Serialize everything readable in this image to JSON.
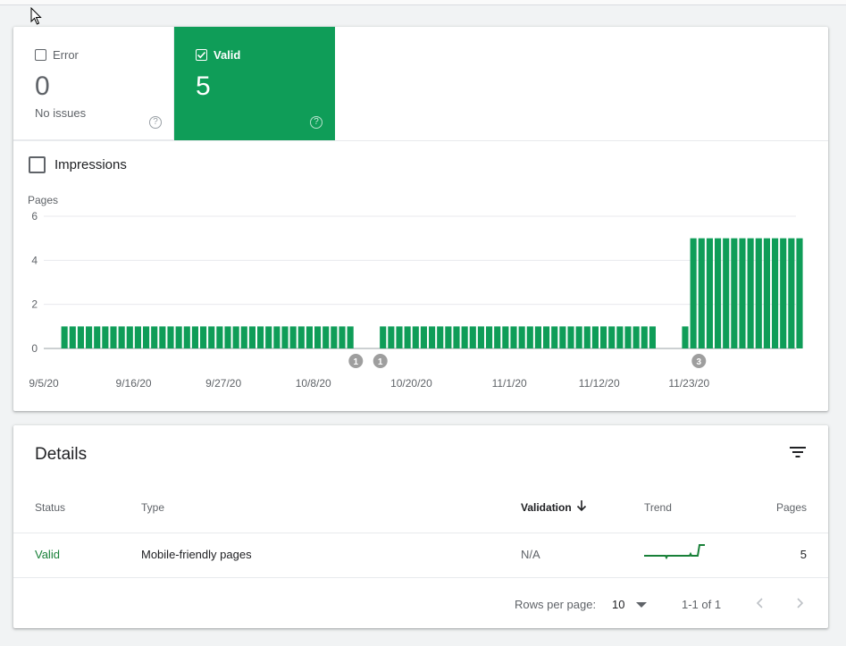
{
  "summary": {
    "error": {
      "label": "Error",
      "count": "0",
      "sub": "No issues"
    },
    "valid": {
      "label": "Valid",
      "count": "5"
    },
    "help_glyph": "?",
    "impressions_label": "Impressions"
  },
  "colors": {
    "valid_green": "#0f9d58",
    "status_green": "#188038",
    "annotation_grey": "#9e9e9e"
  },
  "chart_data": {
    "type": "bar",
    "ylabel": "Pages",
    "ylim": [
      0,
      6
    ],
    "yticks": [
      0,
      2,
      4,
      6
    ],
    "grid": true,
    "x_tick_labels": [
      "9/5/20",
      "9/16/20",
      "9/27/20",
      "10/8/20",
      "10/20/20",
      "11/1/20",
      "11/12/20",
      "11/23/20"
    ],
    "x_tick_days": [
      0,
      11,
      22,
      33,
      45,
      57,
      68,
      79
    ],
    "days": 91,
    "values": [
      null,
      1,
      1,
      1,
      1,
      1,
      1,
      1,
      1,
      1,
      1,
      1,
      1,
      1,
      1,
      1,
      1,
      1,
      1,
      1,
      1,
      1,
      1,
      1,
      1,
      1,
      1,
      1,
      1,
      1,
      1,
      1,
      1,
      1,
      1,
      1,
      1,
      0,
      0,
      0,
      1,
      1,
      1,
      1,
      1,
      1,
      1,
      1,
      1,
      1,
      1,
      1,
      1,
      1,
      1,
      1,
      1,
      1,
      1,
      1,
      1,
      1,
      1,
      1,
      1,
      1,
      1,
      1,
      1,
      1,
      1,
      1,
      1,
      1,
      0,
      0,
      0,
      1,
      5,
      5,
      5,
      5,
      5,
      5,
      5,
      5,
      5,
      5,
      5,
      5,
      5,
      5
    ],
    "annotations": [
      {
        "day": 37,
        "label": "1"
      },
      {
        "day": 40,
        "label": "1"
      },
      {
        "day": 79,
        "label": "3"
      }
    ]
  },
  "details": {
    "title": "Details",
    "columns": {
      "status": "Status",
      "type": "Type",
      "validation": "Validation",
      "trend": "Trend",
      "pages": "Pages"
    },
    "row": {
      "status": "Valid",
      "type": "Mobile-friendly pages",
      "validation": "N/A",
      "pages": "5"
    },
    "footer": {
      "rows_per_page_label": "Rows per page:",
      "rows_per_page_value": "10",
      "range": "1-1 of 1"
    }
  }
}
